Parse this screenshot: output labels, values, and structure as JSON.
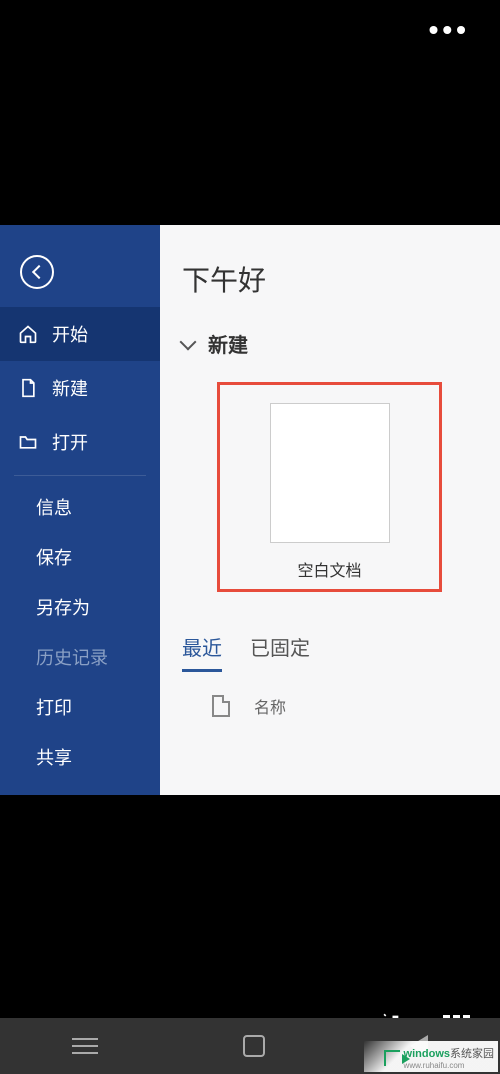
{
  "greeting": "下午好",
  "sidebar": {
    "start": "开始",
    "new": "新建",
    "open": "打开",
    "info": "信息",
    "save": "保存",
    "saveAs": "另存为",
    "history": "历史记录",
    "print": "打印",
    "share": "共享"
  },
  "sections": {
    "new": "新建",
    "blankDoc": "空白文档"
  },
  "tabs": {
    "recent": "最近",
    "pinned": "已固定"
  },
  "list": {
    "name": "名称"
  },
  "watermark": {
    "brand": "windows",
    "sub": "系统家园",
    "url": "www.ruhaifu.com"
  }
}
